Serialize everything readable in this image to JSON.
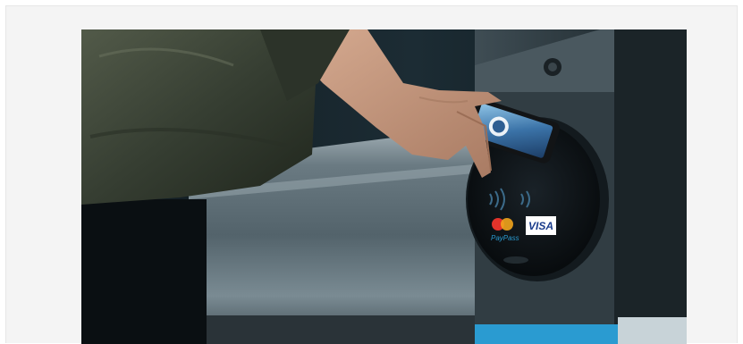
{
  "image": {
    "alt": "",
    "terminal_brands": {
      "brand_1": "VISA",
      "brand_2": "PayPass"
    },
    "colors": {
      "steel": "#6c7c84",
      "terminal_body": "#2e3a40",
      "reader_face": "#0b0f12",
      "accent_blue": "#2a9bd1",
      "jacket": "#3a4235",
      "skin": "#c69a80"
    }
  }
}
